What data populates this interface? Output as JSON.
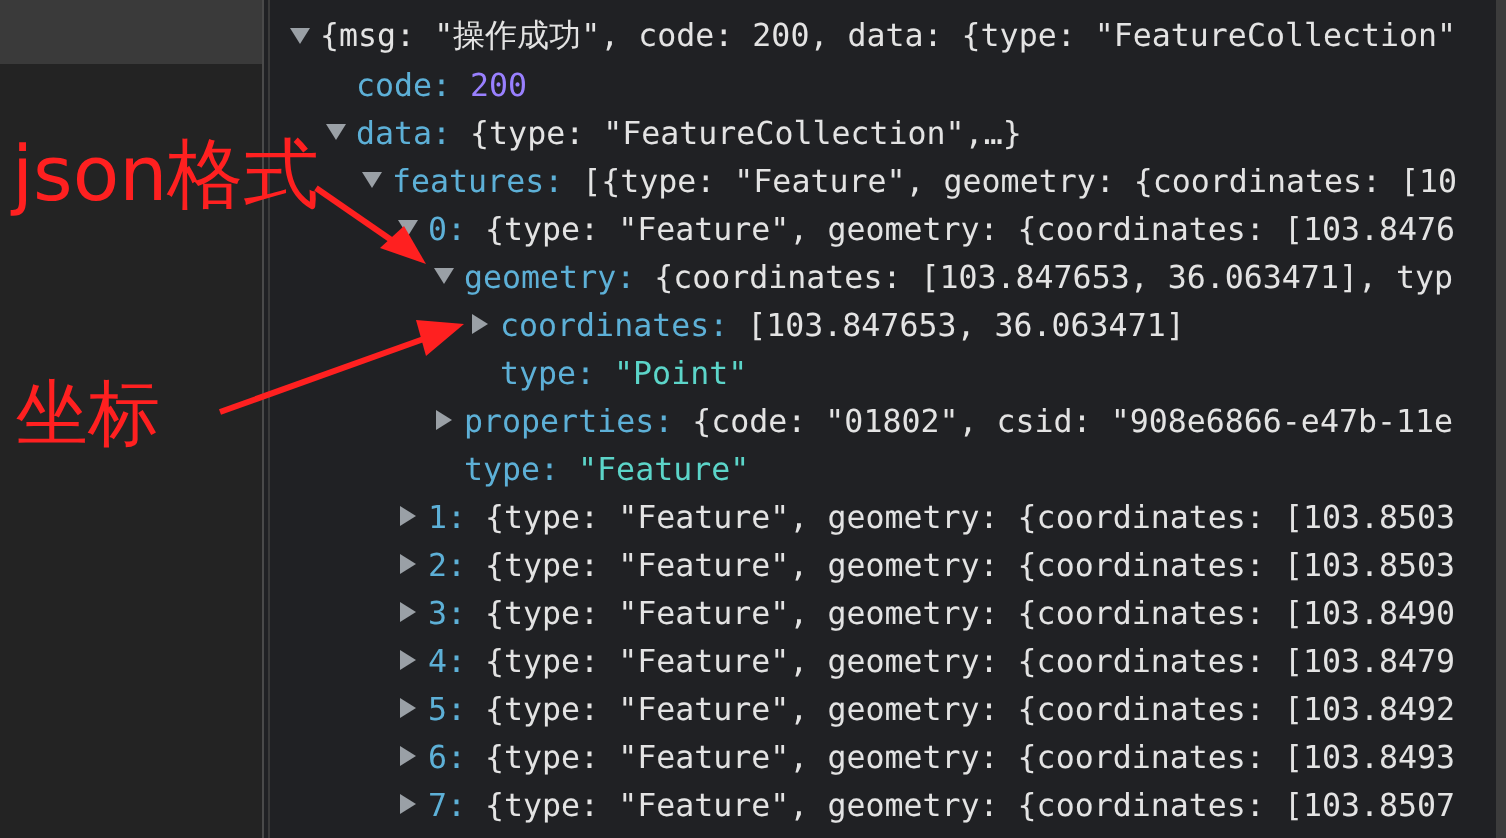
{
  "tree": {
    "value": "{msg: \"操作成功\", code: 200, data: {type: \"FeatureCollection\"",
    "kind": "preview",
    "expanded": true,
    "children": [
      {
        "key": "code:",
        "value": "200",
        "kind": "number"
      },
      {
        "key": "data:",
        "value": "{type: \"FeatureCollection\",…}",
        "kind": "preview",
        "expanded": true,
        "children": [
          {
            "key": "features:",
            "value": "[{type: \"Feature\", geometry: {coordinates: [10",
            "kind": "preview",
            "expanded": true,
            "children": [
              {
                "key": "0:",
                "value": "{type: \"Feature\", geometry: {coordinates: [103.8476",
                "kind": "preview",
                "expanded": true,
                "children": [
                  {
                    "key": "geometry:",
                    "value": "{coordinates: [103.847653, 36.063471], typ",
                    "kind": "preview",
                    "expanded": true,
                    "children": [
                      {
                        "key": "coordinates:",
                        "value": "[103.847653, 36.063471]",
                        "kind": "preview",
                        "expanded": false
                      },
                      {
                        "key": "type:",
                        "value": "\"Point\"",
                        "kind": "string"
                      }
                    ]
                  },
                  {
                    "key": "properties:",
                    "value": "{code: \"01802\", csid: \"908e6866-e47b-11e",
                    "kind": "preview",
                    "expanded": false
                  },
                  {
                    "key": "type:",
                    "value": "\"Feature\"",
                    "kind": "string"
                  }
                ]
              },
              {
                "key": "1:",
                "value": "{type: \"Feature\", geometry: {coordinates: [103.8503",
                "kind": "preview",
                "expanded": false
              },
              {
                "key": "2:",
                "value": "{type: \"Feature\", geometry: {coordinates: [103.8503",
                "kind": "preview",
                "expanded": false
              },
              {
                "key": "3:",
                "value": "{type: \"Feature\", geometry: {coordinates: [103.8490",
                "kind": "preview",
                "expanded": false
              },
              {
                "key": "4:",
                "value": "{type: \"Feature\", geometry: {coordinates: [103.8479",
                "kind": "preview",
                "expanded": false
              },
              {
                "key": "5:",
                "value": "{type: \"Feature\", geometry: {coordinates: [103.8492",
                "kind": "preview",
                "expanded": false
              },
              {
                "key": "6:",
                "value": "{type: \"Feature\", geometry: {coordinates: [103.8493",
                "kind": "preview",
                "expanded": false
              },
              {
                "key": "7:",
                "value": "{type: \"Feature\", geometry: {coordinates: [103.8507",
                "kind": "preview",
                "expanded": false
              }
            ]
          }
        ]
      }
    ]
  },
  "annotations": [
    {
      "label": "json格式"
    },
    {
      "label": "坐标"
    }
  ]
}
